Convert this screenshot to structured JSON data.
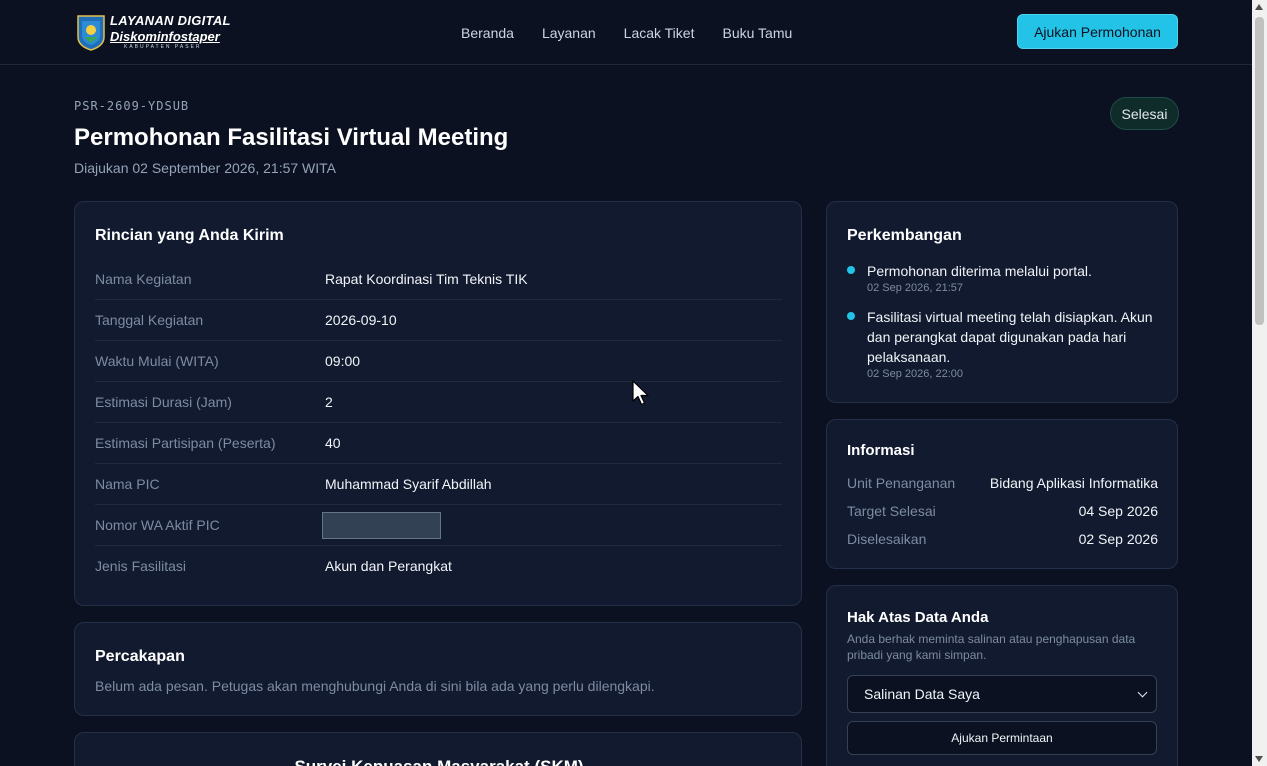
{
  "header": {
    "logo_line1": "LAYANAN DIGITAL",
    "logo_line2": "Diskominfostaper",
    "logo_line3": "KABUPATEN PASER",
    "nav": [
      "Beranda",
      "Layanan",
      "Lacak Tiket",
      "Buku Tamu"
    ],
    "cta_label": "Ajukan Permohonan"
  },
  "ticket": {
    "id": "PSR-2609-YDSUB",
    "title": "Permohonan Fasilitasi Virtual Meeting",
    "submitted": "Diajukan 02 September 2026, 21:57 WITA",
    "status": "Selesai"
  },
  "details": {
    "title": "Rincian yang Anda Kirim",
    "rows": [
      {
        "label": "Nama Kegiatan",
        "value": "Rapat Koordinasi Tim Teknis TIK"
      },
      {
        "label": "Tanggal Kegiatan",
        "value": "2026-09-10"
      },
      {
        "label": "Waktu Mulai (WITA)",
        "value": "09:00"
      },
      {
        "label": "Estimasi Durasi (Jam)",
        "value": "2"
      },
      {
        "label": "Estimasi Partisipan (Peserta)",
        "value": "40"
      },
      {
        "label": "Nama PIC",
        "value": "Muhammad Syarif Abdillah"
      },
      {
        "label": "Nomor WA Aktif PIC",
        "value": ""
      },
      {
        "label": "Jenis Fasilitasi",
        "value": "Akun dan Perangkat"
      }
    ]
  },
  "chat": {
    "title": "Percakapan",
    "empty_text": "Belum ada pesan. Petugas akan menghubungi Anda di sini bila ada yang perlu dilengkapi."
  },
  "survey": {
    "title": "Survei Kepuasan Masyarakat (SKM)"
  },
  "progress": {
    "title": "Perkembangan",
    "items": [
      {
        "text": "Permohonan diterima melalui portal.",
        "time": "02 Sep 2026, 21:57"
      },
      {
        "text": "Fasilitasi virtual meeting telah disiapkan. Akun dan perangkat dapat digunakan pada hari pelaksanaan.",
        "time": "02 Sep 2026, 22:00"
      }
    ]
  },
  "info": {
    "title": "Informasi",
    "rows": [
      {
        "label": "Unit Penanganan",
        "value": "Bidang Aplikasi Informatika"
      },
      {
        "label": "Target Selesai",
        "value": "04 Sep 2026"
      },
      {
        "label": "Diselesaikan",
        "value": "02 Sep 2026"
      }
    ]
  },
  "rights": {
    "title": "Hak Atas Data Anda",
    "description": "Anda berhak meminta salinan atau penghapusan data pribadi yang kami simpan.",
    "select_value": "Salinan Data Saya",
    "button_label": "Ajukan Permintaan"
  },
  "colors": {
    "background": "#0b1120",
    "card": "#111a2e",
    "accent": "#22c3e6"
  }
}
